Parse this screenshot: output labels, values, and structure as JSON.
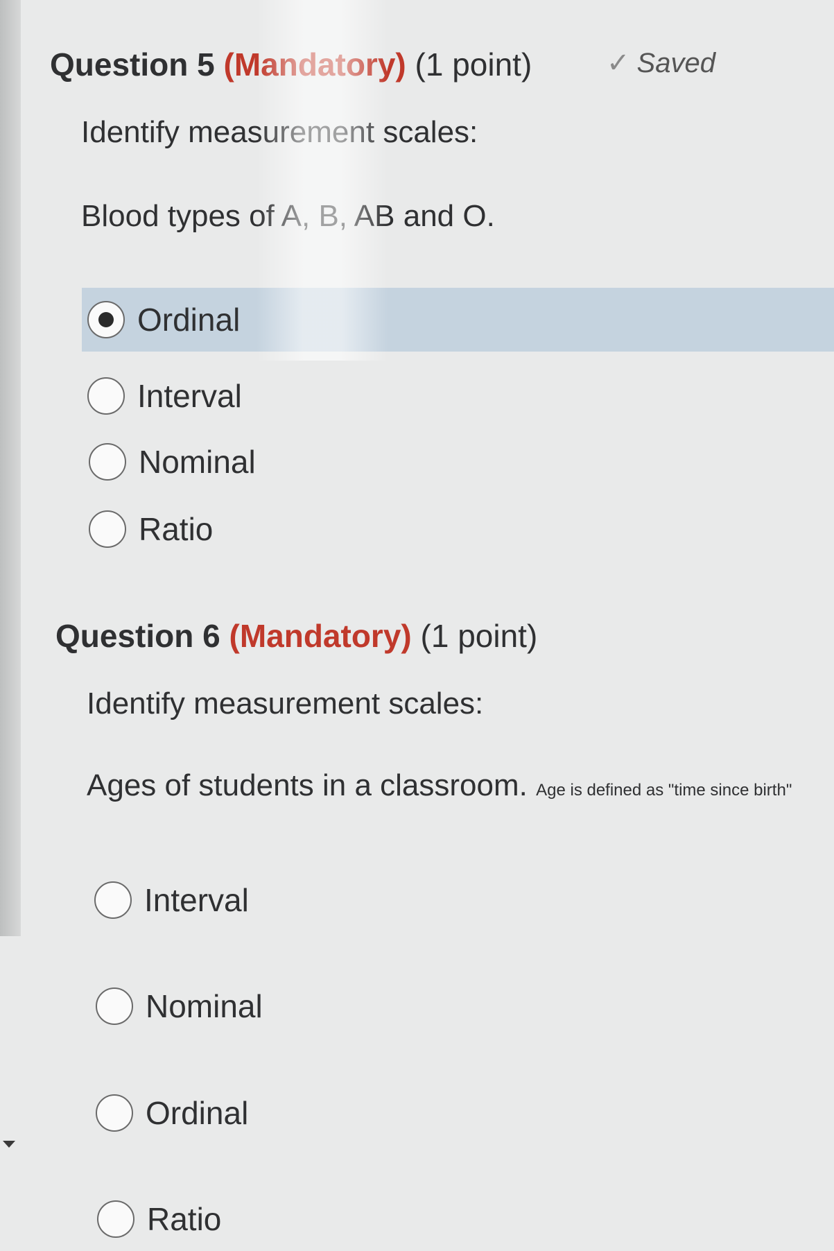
{
  "question5": {
    "number_label": "Question 5",
    "mandatory_label": "(Mandatory)",
    "points_label": "(1 point)",
    "saved_label": "Saved",
    "prompt": "Identify measurement scales:",
    "item": "Blood types of A, B, AB and O.",
    "selected_option": "Ordinal",
    "options": [
      "Ordinal",
      "Interval",
      "Nominal",
      "Ratio"
    ]
  },
  "question6": {
    "number_label": "Question 6",
    "mandatory_label": "(Mandatory)",
    "points_label": "(1 point)",
    "prompt": "Identify measurement scales:",
    "item": "Ages of students in a classroom.",
    "note": "Age is defined as \"time since birth\"",
    "options": [
      "Interval",
      "Nominal",
      "Ordinal",
      "Ratio"
    ]
  },
  "icons": {
    "saved": "check-icon",
    "rail": "triangle-down-icon"
  },
  "colors": {
    "mandatory": "#c0392b",
    "selected_bg": "#c5d3df"
  }
}
